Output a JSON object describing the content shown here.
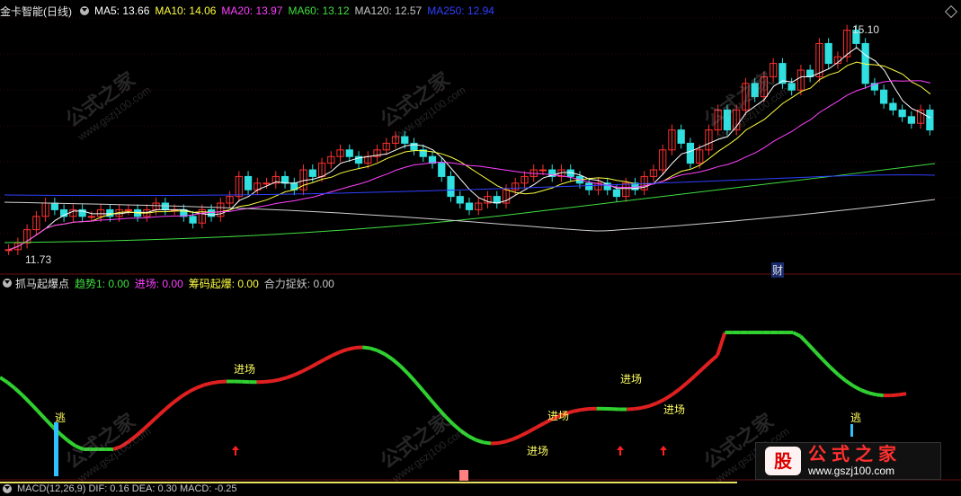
{
  "main_header": {
    "stock_name": "金卡智能(日线)",
    "ma": [
      {
        "label": "MA5: 13.66",
        "color": "#ffffff"
      },
      {
        "label": "MA10: 14.06",
        "color": "#ffff40"
      },
      {
        "label": "MA20: 13.97",
        "color": "#ff40ff"
      },
      {
        "label": "MA60: 13.12",
        "color": "#40e040"
      },
      {
        "label": "MA120: 12.57",
        "color": "#c8c8c8"
      },
      {
        "label": "MA250: 12.94",
        "color": "#3040ff"
      }
    ]
  },
  "price_labels": {
    "high": "15.10",
    "low": "11.73",
    "finance_marker": "财"
  },
  "indicator_header": {
    "name": "抓马起爆点",
    "items": [
      {
        "label": "趋势1: 0.00",
        "color": "#40e040"
      },
      {
        "label": "进场: 0.00",
        "color": "#ff40ff"
      },
      {
        "label": "筹码起爆: 0.00",
        "color": "#ffff40"
      },
      {
        "label": "合力捉妖: 0.00",
        "color": "#c8c8c8"
      }
    ]
  },
  "signals": {
    "entry": "进场",
    "escape": "逃"
  },
  "macd_header": {
    "text": "MACD(12,26,9)  DIF: 0.16  DEA: 0.30  MACD: -0.25"
  },
  "watermark": {
    "cn": "公式之家",
    "url": "www.gszj100.com"
  },
  "badge": {
    "logo": "股",
    "title": "公式之家",
    "url": "www.gszj100.com"
  },
  "colors": {
    "up": "#ff3030",
    "down": "#30e0e0",
    "ind_green": "#30d030",
    "ind_red": "#e02020"
  }
}
